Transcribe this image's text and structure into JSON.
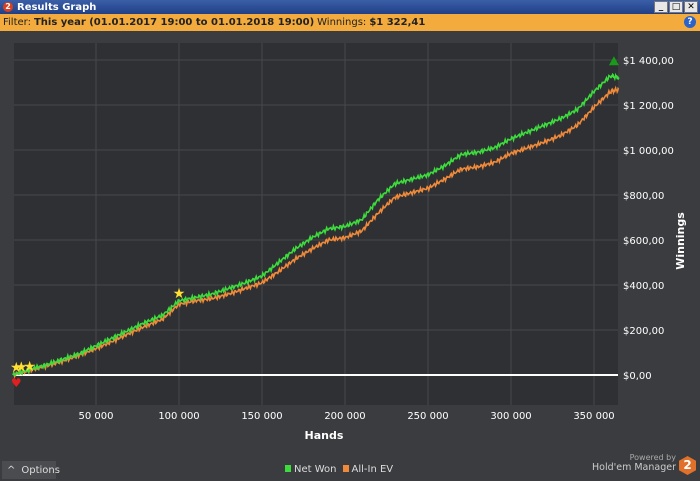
{
  "window": {
    "title": "Results Graph",
    "icon_text": "2",
    "buttons": [
      "_",
      "□",
      "✕"
    ]
  },
  "filter": {
    "label": "Filter:",
    "value": "This year (01.01.2017 19:00 to 01.01.2018 19:00)",
    "winnings_label": "Winnings:",
    "winnings_value": "$1 322,41",
    "help": "?"
  },
  "footer": {
    "options_label": "Options",
    "options_icon": "^",
    "powered_by": "Powered by",
    "brand": "Hold'em Manager",
    "brand_logo": "2"
  },
  "chart_data": {
    "type": "line",
    "xlabel": "Hands",
    "ylabel": "Winnings",
    "xlim": [
      0,
      365000
    ],
    "ylim": [
      -100,
      1500
    ],
    "xticks": [
      50000,
      100000,
      150000,
      200000,
      250000,
      300000,
      350000
    ],
    "xtick_labels": [
      "50 000",
      "100 000",
      "150 000",
      "200 000",
      "250 000",
      "300 000",
      "350 000"
    ],
    "yticks": [
      0,
      200,
      400,
      600,
      800,
      1000,
      1200,
      1400
    ],
    "ytick_labels": [
      "$0,00",
      "$200,00",
      "$400,00",
      "$600,00",
      "$800,00",
      "$1 000,00",
      "$1 200,00",
      "$1 400,00"
    ],
    "grid": true,
    "legend": "bottom-center",
    "x": [
      0,
      10000,
      20000,
      30000,
      40000,
      50000,
      60000,
      70000,
      80000,
      90000,
      100000,
      110000,
      120000,
      130000,
      140000,
      150000,
      160000,
      170000,
      180000,
      190000,
      200000,
      210000,
      220000,
      230000,
      240000,
      250000,
      260000,
      270000,
      280000,
      290000,
      300000,
      310000,
      320000,
      330000,
      340000,
      350000,
      360000,
      365000
    ],
    "series": [
      {
        "name": "Net Won",
        "color": "#3ddc3d",
        "values": [
          0,
          25,
          45,
          70,
          95,
          130,
          165,
          200,
          235,
          265,
          330,
          345,
          360,
          385,
          410,
          440,
          500,
          560,
          610,
          650,
          660,
          690,
          780,
          850,
          870,
          890,
          930,
          980,
          990,
          1010,
          1050,
          1080,
          1110,
          1140,
          1180,
          1260,
          1330,
          1322
        ]
      },
      {
        "name": "All-In EV",
        "color": "#f08a3a",
        "values": [
          0,
          20,
          40,
          62,
          88,
          118,
          150,
          185,
          218,
          248,
          315,
          330,
          340,
          360,
          385,
          410,
          460,
          515,
          560,
          600,
          610,
          640,
          720,
          790,
          810,
          830,
          870,
          915,
          925,
          945,
          985,
          1010,
          1035,
          1065,
          1110,
          1190,
          1260,
          1270
        ]
      }
    ],
    "markers": [
      {
        "type": "star",
        "x": 2000,
        "y": 35
      },
      {
        "type": "star",
        "x": 5000,
        "y": 38
      },
      {
        "type": "star",
        "x": 10000,
        "y": 40
      },
      {
        "type": "star",
        "x": 100000,
        "y": 365
      },
      {
        "type": "min",
        "x": 2000,
        "y": -30
      },
      {
        "type": "max",
        "x": 362000,
        "y": 1390
      }
    ]
  }
}
